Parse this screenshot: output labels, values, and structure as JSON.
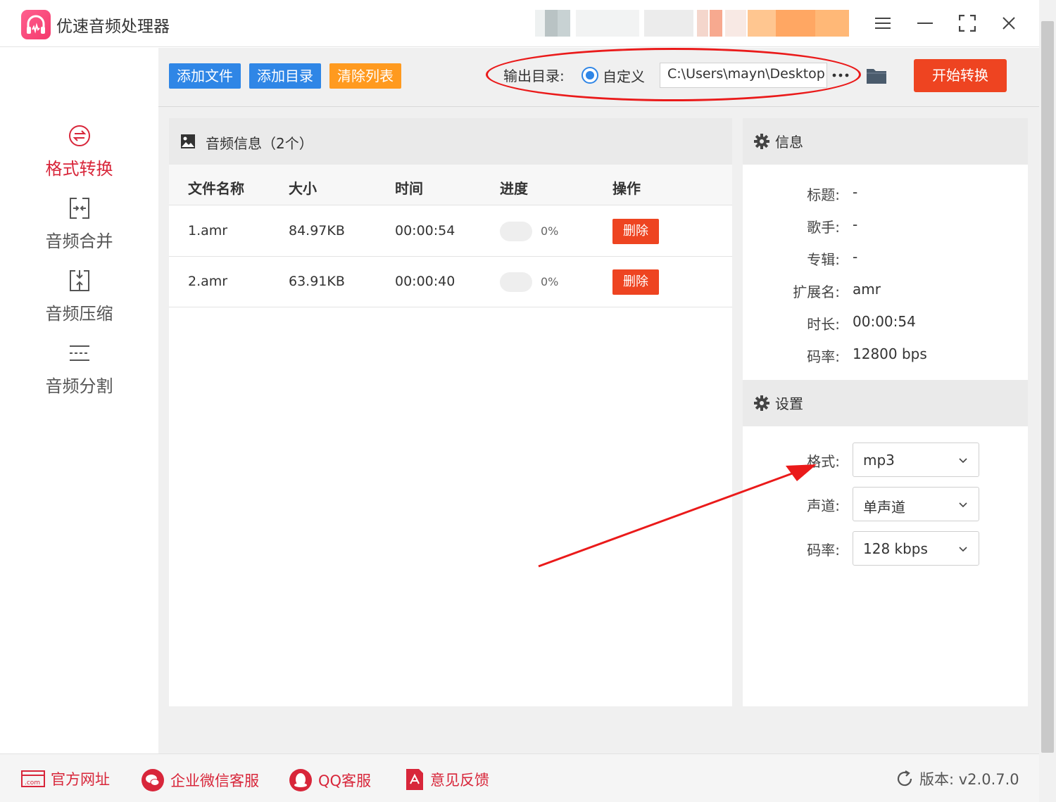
{
  "app": {
    "title": "优速音频处理器"
  },
  "sidebar": {
    "items": [
      {
        "label": "格式转换",
        "icon": "format-convert-icon",
        "active": true
      },
      {
        "label": "音频合并",
        "icon": "merge-icon",
        "active": false
      },
      {
        "label": "音频压缩",
        "icon": "compress-icon",
        "active": false
      },
      {
        "label": "音频分割",
        "icon": "split-icon",
        "active": false
      }
    ]
  },
  "toolbar": {
    "add_file": "添加文件",
    "add_folder": "添加目录",
    "clear_list": "清除列表",
    "output_label": "输出目录:",
    "radio_custom": "自定义",
    "output_path": "C:\\Users\\mayn\\Desktop",
    "start": "开始转换"
  },
  "files": {
    "title": "音频信息（2个）",
    "headers": {
      "name": "文件名称",
      "size": "大小",
      "time": "时间",
      "progress": "进度",
      "action": "操作"
    },
    "rows": [
      {
        "name": "1.amr",
        "size": "84.97KB",
        "time": "00:00:54",
        "progress": 0,
        "progress_text": "0%",
        "action": "删除"
      },
      {
        "name": "2.amr",
        "size": "63.91KB",
        "time": "00:00:40",
        "progress": 0,
        "progress_text": "0%",
        "action": "删除"
      }
    ]
  },
  "info": {
    "title": "信息",
    "fields": [
      {
        "label": "标题:",
        "value": "-"
      },
      {
        "label": "歌手:",
        "value": "-"
      },
      {
        "label": "专辑:",
        "value": "-"
      },
      {
        "label": "扩展名:",
        "value": "amr"
      },
      {
        "label": "时长:",
        "value": "00:00:54"
      },
      {
        "label": "码率:",
        "value": "12800 bps"
      }
    ]
  },
  "settings": {
    "title": "设置",
    "fields": [
      {
        "label": "格式:",
        "value": "mp3"
      },
      {
        "label": "声道:",
        "value": "单声道"
      },
      {
        "label": "码率:",
        "value": "128 kbps"
      }
    ]
  },
  "footer": {
    "website": "官方网址",
    "wechat": "企业微信客服",
    "qq": "QQ客服",
    "feedback": "意见反馈",
    "version": "版本: v2.0.7.0"
  },
  "colors": {
    "accent_red": "#d8263a",
    "button_blue": "#2f86e6",
    "button_orange": "#ff9a1f",
    "start_red": "#ee4421"
  }
}
